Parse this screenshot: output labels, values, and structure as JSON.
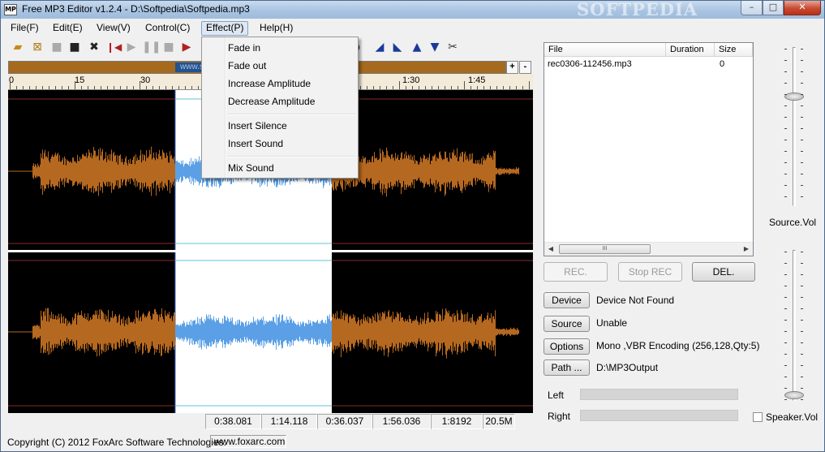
{
  "window": {
    "title": "Free MP3 Editor v1.2.4 - D:\\Softpedia\\Softpedia.mp3",
    "watermark": "SOFTPEDIA",
    "controls": {
      "minimize": "–",
      "maximize": "□",
      "close": "✕"
    }
  },
  "menu": [
    "File(F)",
    "Edit(E)",
    "View(V)",
    "Control(C)",
    "Effect(P)",
    "Help(H)"
  ],
  "effect_menu": {
    "group1": [
      "Fade in",
      "Fade out",
      "Increase Amplitude",
      "Decrease Amplitude"
    ],
    "group2": [
      "Insert Silence",
      "Insert Sound"
    ],
    "group3": [
      "Mix Sound"
    ]
  },
  "toolbar_icons": [
    "open-folder-icon",
    "new-file-icon",
    "save-icon",
    "save-as-icon",
    "delete-icon",
    "skip-to-start-icon",
    "play-icon",
    "pause-icon",
    "stop-icon",
    "play-selection-icon",
    "triangle-left-icon",
    "triangle-right-icon",
    "triangle-up-icon",
    "triangle-down-icon",
    "split-icon"
  ],
  "overview": {
    "watermark": "www.softpedia",
    "zoom_in": "+",
    "zoom_out": "-"
  },
  "ruler": [
    "0",
    "15",
    "30",
    "1:30",
    "1:45"
  ],
  "time_readouts": [
    "0:38.081",
    "1:14.118",
    "0:36.037",
    "1:56.036",
    "1:8192",
    "20.5M"
  ],
  "file_list": {
    "columns": [
      "File",
      "Duration",
      "Size"
    ],
    "rows": [
      {
        "file": "rec0306-112456.mp3",
        "duration": "",
        "size": "0"
      }
    ],
    "scroll_thumb": "III"
  },
  "record_buttons": {
    "rec": "REC.",
    "stop_rec": "Stop REC",
    "delete": "DEL."
  },
  "settings": {
    "device": {
      "button": "Device",
      "value": "Device Not Found"
    },
    "source": {
      "button": "Source",
      "value": "Unable"
    },
    "options": {
      "button": "Options",
      "value": "Mono  ,VBR Encoding  (256,128,Qty:5)"
    },
    "path": {
      "button": "Path ...",
      "value": "D:\\MP3Output"
    }
  },
  "meters": {
    "left": "Left",
    "right": "Right"
  },
  "volume": {
    "source_label": "Source.Vol",
    "speaker_label": "Speaker.Vol"
  },
  "status": {
    "copyright": "Copyright (C) 2012 FoxArc Software Technologies.",
    "url": "www.foxarc.com"
  },
  "colors": {
    "waveform": "#b5681f",
    "selection_wave": "#5ba0e6",
    "background": "#000000",
    "selection_bg": "#ffffff"
  }
}
